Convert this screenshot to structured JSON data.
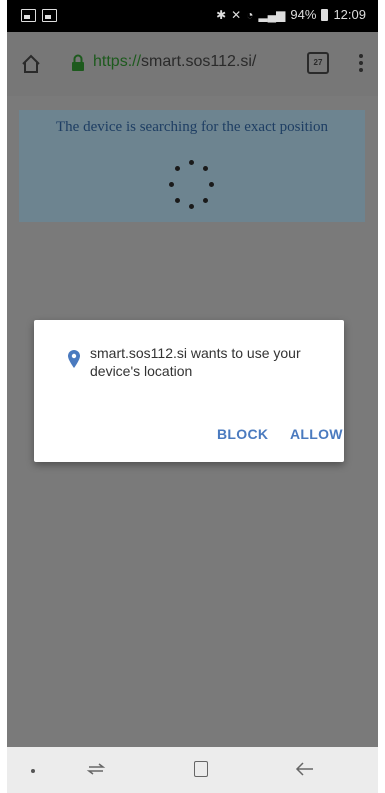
{
  "status_bar": {
    "battery": "94%",
    "time": "12:09"
  },
  "browser": {
    "url_scheme": "https://",
    "url_host": "smart.sos112.si/",
    "tab_count": "27"
  },
  "page": {
    "banner_text": "The device is searching for the exact position"
  },
  "dialog": {
    "message": "smart.sos112.si wants to use your device's location",
    "block_label": "BLOCK",
    "allow_label": "ALLOW"
  },
  "colors": {
    "dialog_button": "#4a7abf",
    "scrim": "#7a7a7a"
  }
}
